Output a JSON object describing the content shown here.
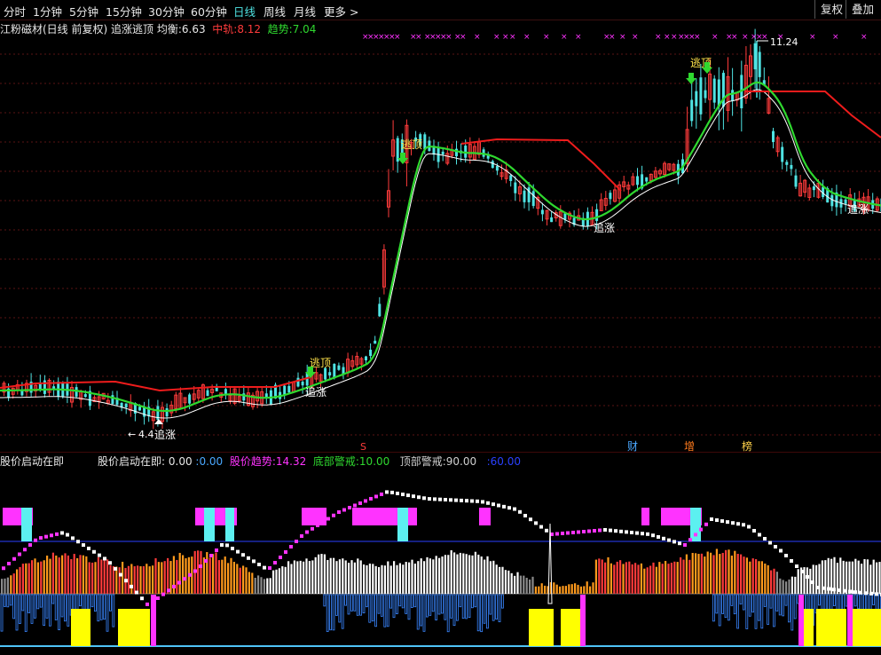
{
  "toolbar": {
    "periods": [
      "分时",
      "1分钟",
      "5分钟",
      "15分钟",
      "30分钟",
      "60分钟",
      "日线",
      "周线",
      "月线",
      "更多 >"
    ],
    "active_period": "日线",
    "right_buttons": [
      "复权",
      "叠加"
    ]
  },
  "main_header": {
    "title": "江粉磁材(日线 前复权)",
    "indicator_name": "追涨逃顶",
    "junheng_label": "均衡:",
    "junheng_value": "6.63",
    "zhonggui_label": "中轨:",
    "zhonggui_value": "8.12",
    "qushi_label": "趋势:",
    "qushi_value": "7.04"
  },
  "main_labels": {
    "high_price": "11.24",
    "low_price": "4.4",
    "taoding": "逃顶",
    "zhuizhang": "追涨",
    "event_s": "S",
    "event_cai": "财",
    "event_zeng": "增",
    "event_bang": "榜"
  },
  "sub_header": {
    "title": "股价启动在即",
    "item1_label": "股价启动在即:",
    "item1_value": "0.00",
    "item2_value": ":0.00",
    "item3_label": "股价趋势:",
    "item3_value": "14.32",
    "item4_label": "底部警戒:",
    "item4_value": "10.00",
    "item5_label": "顶部警戒:",
    "item5_value": "90.00",
    "item6_value": ":60.00"
  },
  "colors": {
    "up": "#ff3b3b",
    "down": "#4fe3e3",
    "white": "#ffffff",
    "green": "#2fd82f",
    "red": "#ee1c1c",
    "magenta": "#ff33ff",
    "yellow": "#ffff00",
    "blue": "#3a86ff",
    "grey": "#8a8a8a",
    "cyan_bar": "#5cf0f0"
  }
}
